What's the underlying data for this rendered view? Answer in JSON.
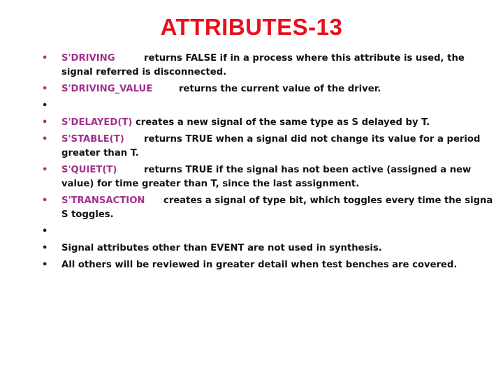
{
  "slide": {
    "title": "ATTRIBUTES-13",
    "title_color": "#e8101c",
    "attribute_color": "#a2308f",
    "bullet_glyph": "•",
    "items": [
      {
        "attribute": "S'DRIVING",
        "description": "returns  FALSE if in a process where this attribute is used, the signal  referred is disconnected."
      },
      {
        "attribute": "S'DRIVING_VALUE",
        "description": "returns the current value of the driver."
      },
      {
        "attribute": "",
        "description": ""
      },
      {
        "attribute": "S'DELAYED(T)",
        "description": " creates a new signal of the same type as S  delayed by T."
      },
      {
        "attribute": "S'STABLE(T)",
        "description": "returns TRUE when a signal did not change its value for a period greater than T."
      },
      {
        "attribute": "S'QUIET(T)",
        "description": "returns TRUE if the signal has not been active (assigned a new value) for time greater than T, since the last assignment."
      },
      {
        "attribute": "S'TRANSACTION",
        "description": "creates a signal of type bit, which toggles every time the  signa S toggles."
      },
      {
        "attribute": "",
        "description": ""
      },
      {
        "attribute": "",
        "description": "Signal attributes other than EVENT are not used in synthesis."
      },
      {
        "attribute": "",
        "description": "All others will be reviewed in greater detail when test benches are covered."
      }
    ]
  }
}
